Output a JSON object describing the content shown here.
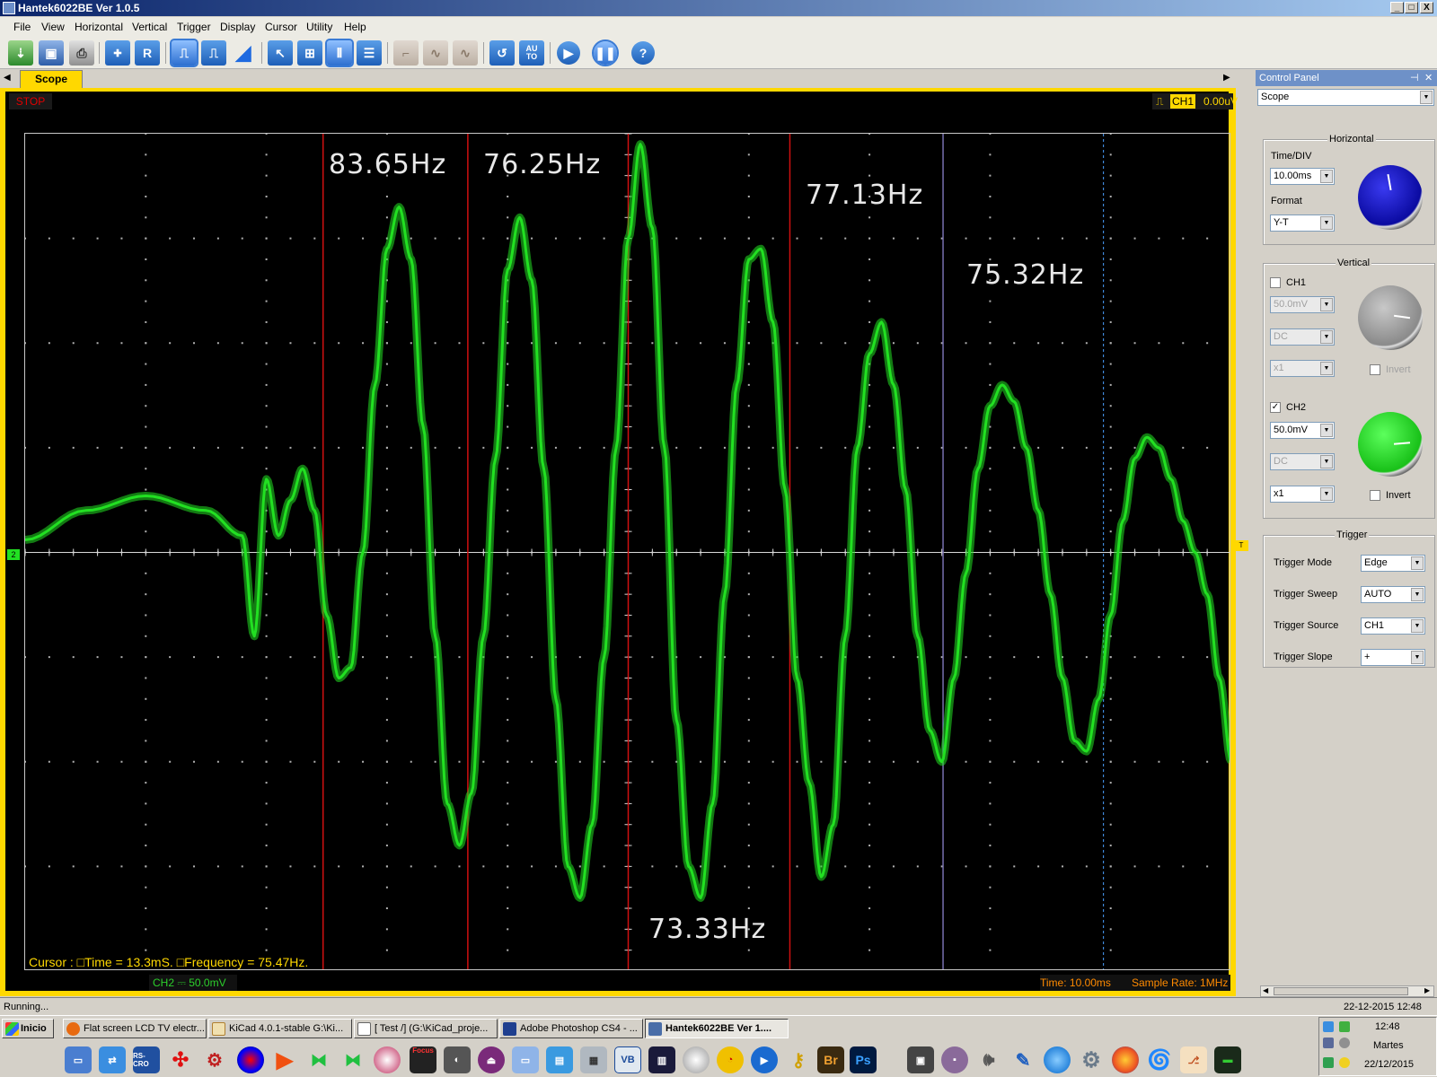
{
  "window": {
    "title": "Hantek6022BE Ver 1.0.5",
    "minimize": "_",
    "maximize": "□",
    "close": "X"
  },
  "menu": [
    "File",
    "View",
    "Horizontal",
    "Vertical",
    "Trigger",
    "Display",
    "Cursor",
    "Utility",
    "Help"
  ],
  "toolbar_icons": [
    "import-icon",
    "save-icon",
    "print-icon",
    "auto-set-icon",
    "reference-icon",
    "square-wave-icon",
    "pulse-wave-icon",
    "ramp-wave-icon",
    "cursor-select-icon",
    "cursor-cross-icon",
    "cursor-vertical-icon",
    "cursor-horizontal-icon",
    "step-icon",
    "sine-small-icon",
    "sine-icon",
    "reset-icon",
    "auto-icon",
    "play-icon",
    "pause-icon",
    "help-icon"
  ],
  "toolbar_text": {
    "ref": "R",
    "auto": "AU TO",
    "help": "?"
  },
  "tab": {
    "label": "Scope"
  },
  "scope": {
    "run_state": "STOP",
    "trigger_channel": "CH1",
    "trigger_level": "0.00uV",
    "channel_marker": "2",
    "trigger_marker": "T",
    "cursor_readout": "Cursor : □Time = 13.3mS. □Frequency = 75.47Hz.",
    "ch2_indicator": "CH2 ⎓   50.0mV",
    "time_indicator": "Time: 10.00ms",
    "sample_rate": "Sample Rate: 1MHz",
    "annotations": [
      "83.65Hz",
      "76.25Hz",
      "77.13Hz",
      "75.32Hz",
      "73.33Hz"
    ],
    "colors": {
      "trace": "#22e022",
      "cursor_red": "#d01010",
      "cursor_blue": "#4aa0ff",
      "frame": "#ffd800",
      "background": "#000000"
    }
  },
  "chart_data": {
    "type": "line",
    "title": "",
    "xlabel": "",
    "ylabel": "",
    "xlim": [
      -50,
      50
    ],
    "ylim": [
      -200,
      200
    ],
    "x_unit": "ms",
    "y_unit": "mV",
    "grid": true,
    "series": [
      {
        "name": "CH2",
        "x": [
          -50,
          -45,
          -40,
          -35,
          -32,
          -31,
          -30,
          -29,
          -28,
          -27,
          -26,
          -25,
          -24,
          -23,
          -22,
          -21,
          -20,
          -19,
          -18,
          -17,
          -16,
          -15,
          -14,
          -13,
          -12,
          -11,
          -10,
          -9,
          -8,
          -7,
          -6,
          -5,
          -4,
          -3,
          -2,
          -1,
          0,
          1,
          2,
          3,
          4,
          5,
          6,
          7,
          8,
          9,
          10,
          11,
          12,
          13,
          14,
          15,
          16,
          17,
          18,
          19,
          20,
          21,
          22,
          23,
          24,
          25,
          26,
          27,
          28,
          29,
          30,
          31,
          32,
          33,
          34,
          35,
          36,
          37,
          38,
          39,
          40,
          41,
          42,
          43,
          44,
          45,
          46,
          47,
          48,
          49,
          50
        ],
        "y": [
          6,
          20,
          27,
          20,
          8,
          -40,
          35,
          8,
          25,
          40,
          20,
          -30,
          -60,
          -55,
          0,
          80,
          145,
          165,
          140,
          60,
          -40,
          -120,
          -140,
          -115,
          -40,
          45,
          135,
          160,
          130,
          40,
          -70,
          -150,
          -165,
          -130,
          -50,
          50,
          150,
          195,
          155,
          50,
          -80,
          -150,
          -165,
          -120,
          -20,
          80,
          140,
          145,
          110,
          30,
          -60,
          -110,
          -155,
          -130,
          -40,
          50,
          95,
          110,
          80,
          30,
          -40,
          -85,
          -100,
          -60,
          -10,
          40,
          70,
          80,
          72,
          50,
          20,
          -20,
          -60,
          -90,
          -95,
          -70,
          -30,
          15,
          45,
          55,
          50,
          35,
          15,
          0,
          -20,
          -60,
          -100
        ]
      }
    ]
  },
  "cursors": {
    "red_lines_ms": [
      -25.3,
      -13.3,
      0,
      13.4,
      26.1
    ],
    "blue_lines_ms": [
      26.1,
      39.4
    ]
  },
  "control_panel": {
    "title": "Control Panel",
    "mode": "Scope",
    "horizontal": {
      "title": "Horizontal",
      "timediv_label": "Time/DIV",
      "timediv": "10.00ms",
      "format_label": "Format",
      "format": "Y-T",
      "knob_color": "#0a0aa0"
    },
    "vertical": {
      "title": "Vertical",
      "ch1": {
        "label": "CH1",
        "enabled": false,
        "volts": "50.0mV",
        "coupling": "DC",
        "probe": "x1",
        "invert_label": "Invert",
        "knob_color": "#9a9a9a"
      },
      "ch2": {
        "label": "CH2",
        "enabled": true,
        "volts": "50.0mV",
        "coupling": "DC",
        "probe": "x1",
        "invert_label": "Invert",
        "knob_color": "#18e018"
      }
    },
    "trigger": {
      "title": "Trigger",
      "mode_label": "Trigger Mode",
      "mode": "Edge",
      "sweep_label": "Trigger Sweep",
      "sweep": "AUTO",
      "source_label": "Trigger Source",
      "source": "CH1",
      "slope_label": "Trigger Slope",
      "slope": "+"
    },
    "checkmark": "✓"
  },
  "status": {
    "left": "Running...",
    "datetime": "22-12-2015   12:48"
  },
  "taskbar": {
    "start": "Inicio",
    "tasks": [
      "Flat screen LCD TV electr...",
      "KiCad 4.0.1-stable G:\\Ki...",
      "[ Test /] (G:\\KiCad_proje...",
      "Adobe Photoshop CS4 - ...",
      "Hantek6022BE Ver 1...."
    ],
    "quick": [
      "Br",
      "Ps",
      "VB",
      "RS-CRO",
      "Focus"
    ],
    "clock": {
      "time": "12:48",
      "day": "Martes",
      "date": "22/12/2015"
    }
  }
}
